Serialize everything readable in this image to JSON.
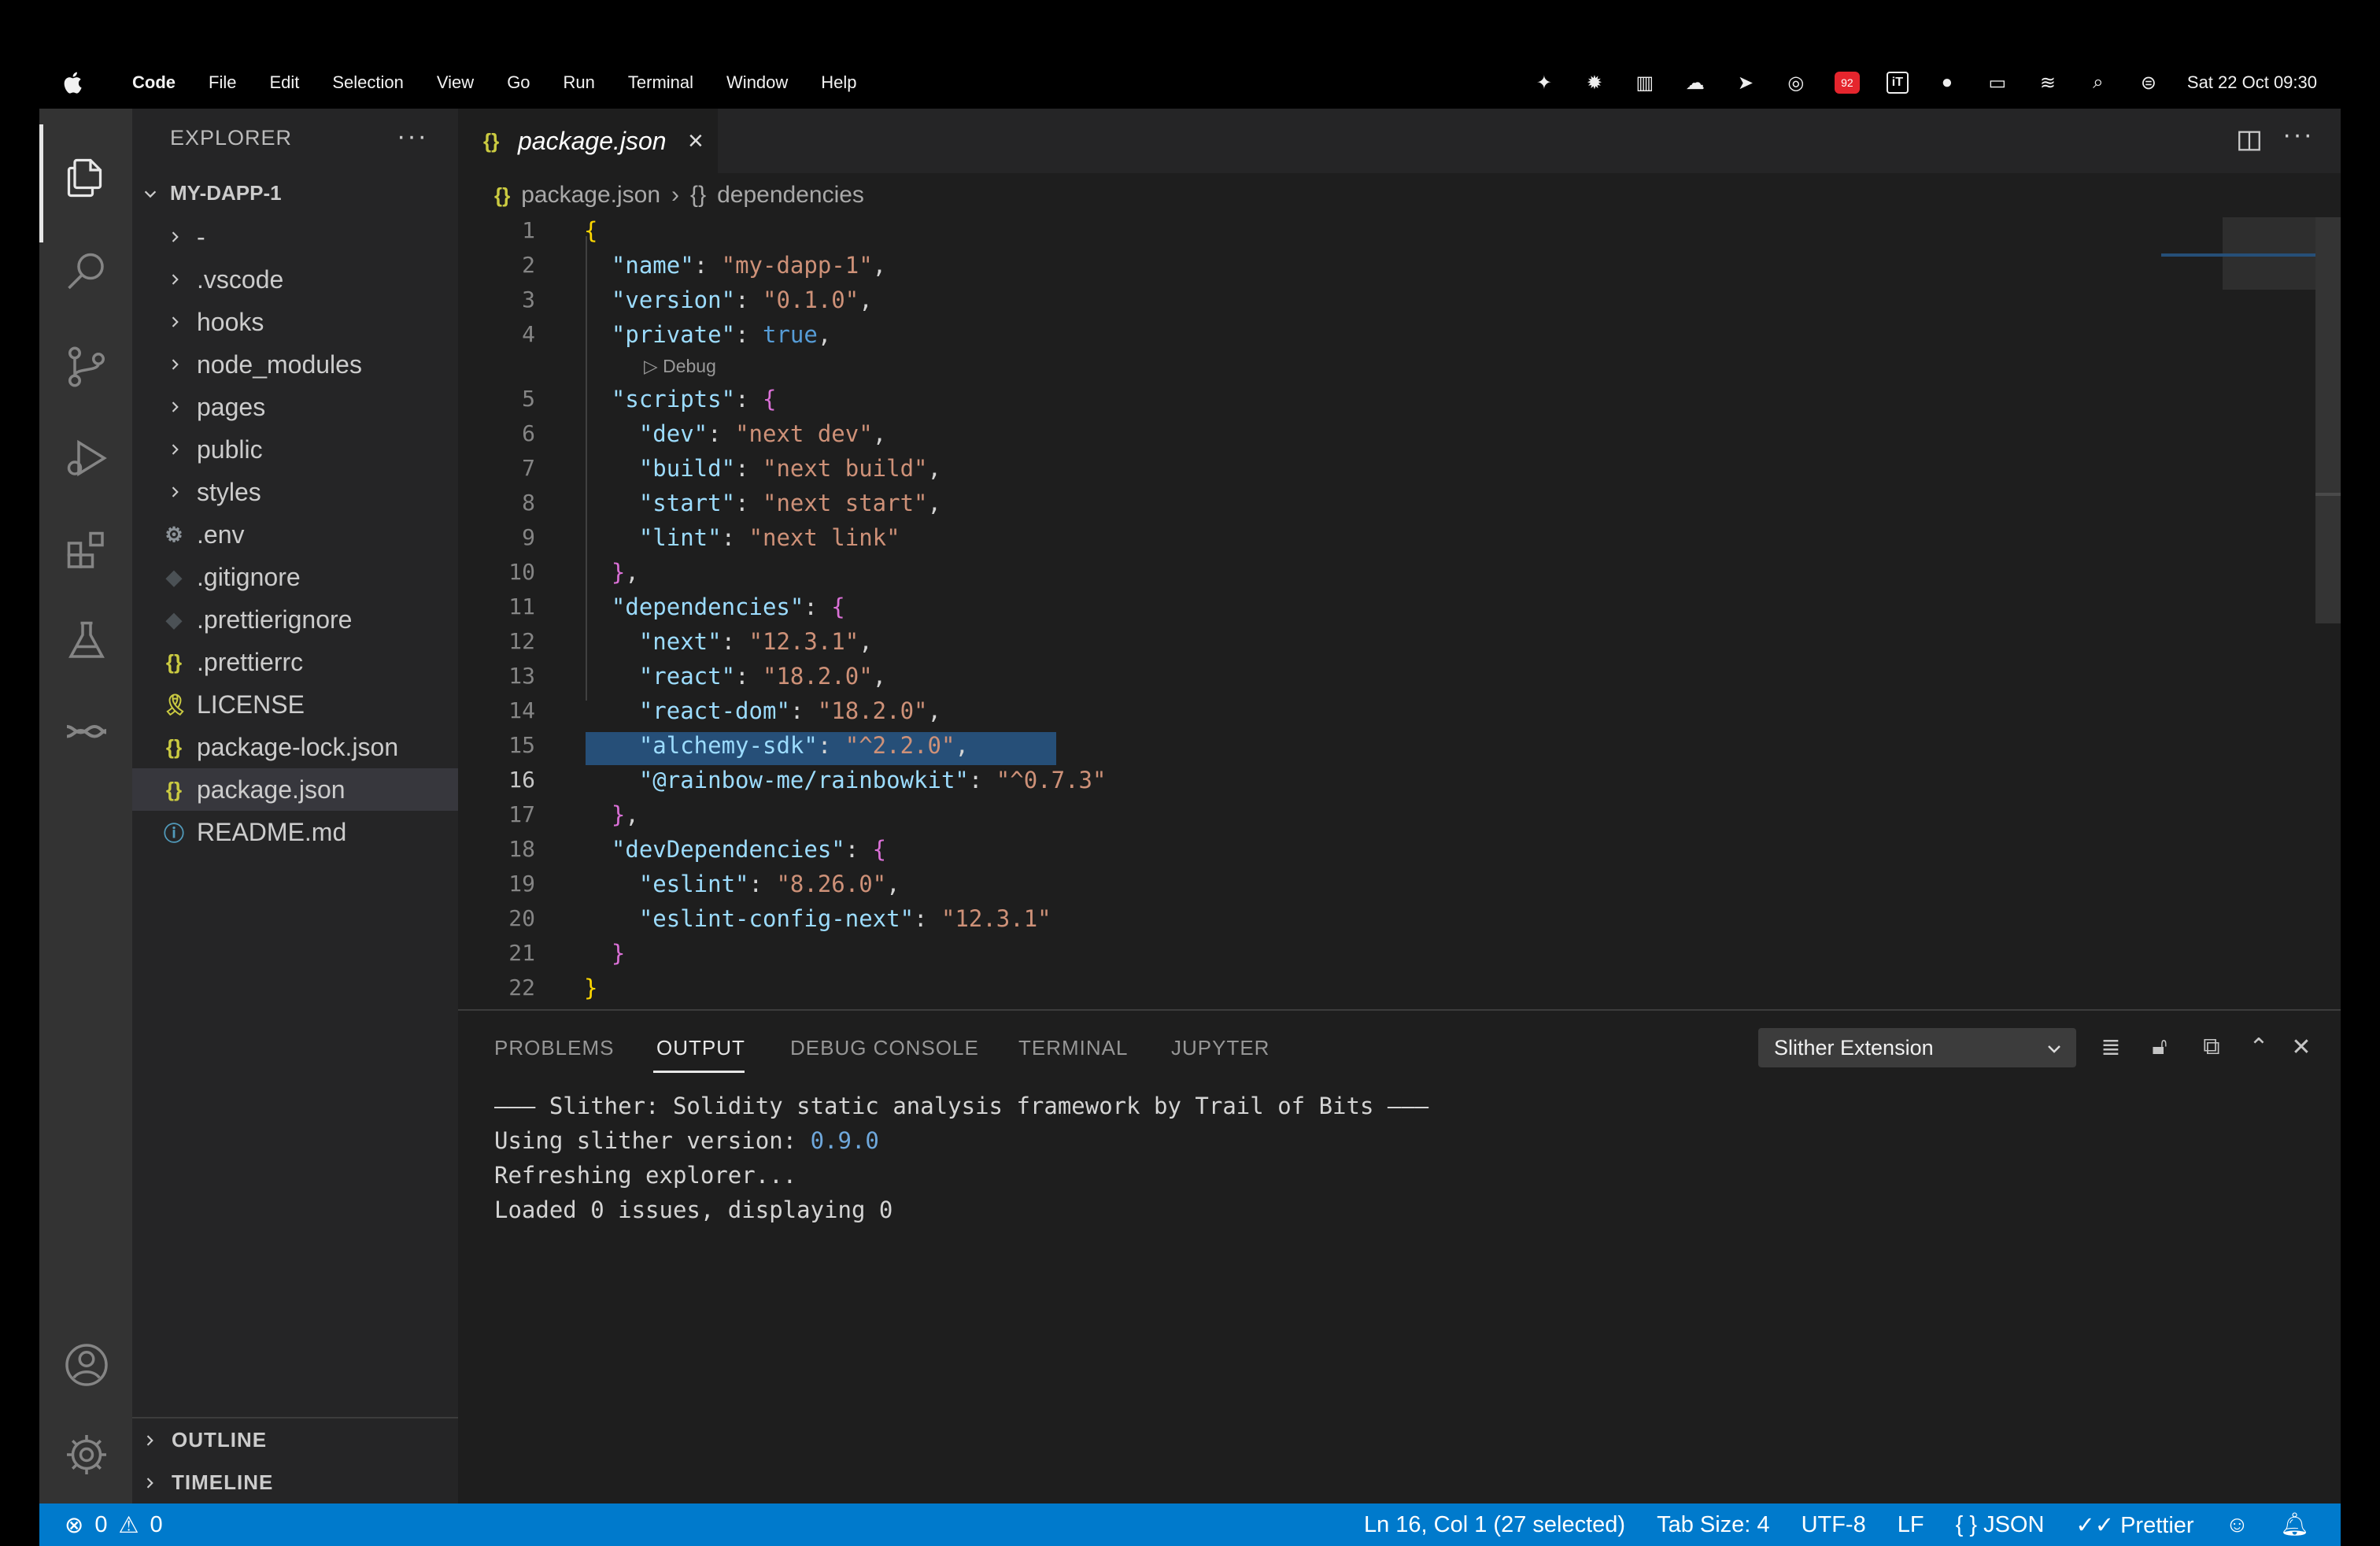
{
  "menubar": {
    "app_name": "Code",
    "items": [
      "File",
      "Edit",
      "Selection",
      "View",
      "Go",
      "Run",
      "Terminal",
      "Window",
      "Help"
    ],
    "clock": "Sat 22 Oct  09:30",
    "badge_count": "92",
    "box_icon_letter": "iT"
  },
  "sidebar": {
    "title": "EXPLORER",
    "root": "MY-DAPP-1",
    "items": [
      {
        "label": "-",
        "type": "folder"
      },
      {
        "label": ".vscode",
        "type": "folder"
      },
      {
        "label": "hooks",
        "type": "folder"
      },
      {
        "label": "node_modules",
        "type": "folder"
      },
      {
        "label": "pages",
        "type": "folder"
      },
      {
        "label": "public",
        "type": "folder"
      },
      {
        "label": "styles",
        "type": "folder"
      },
      {
        "label": ".env",
        "type": "gear"
      },
      {
        "label": ".gitignore",
        "type": "diamond"
      },
      {
        "label": ".prettierignore",
        "type": "diamond"
      },
      {
        "label": ".prettierrc",
        "type": "json"
      },
      {
        "label": "LICENSE",
        "type": "license"
      },
      {
        "label": "package-lock.json",
        "type": "json"
      },
      {
        "label": "package.json",
        "type": "json"
      },
      {
        "label": "README.md",
        "type": "info"
      }
    ],
    "outline": "OUTLINE",
    "timeline": "TIMELINE"
  },
  "editor": {
    "tab_label": "package.json",
    "breadcrumb": [
      "package.json",
      "dependencies"
    ],
    "codelens": "Debug",
    "line_numbers": [
      "1",
      "2",
      "3",
      "4",
      "5",
      "6",
      "7",
      "8",
      "9",
      "10",
      "11",
      "12",
      "13",
      "14",
      "15",
      "16",
      "17",
      "18",
      "19",
      "20",
      "21",
      "22"
    ],
    "current_line": "16"
  },
  "panel": {
    "tabs": [
      "PROBLEMS",
      "OUTPUT",
      "DEBUG CONSOLE",
      "TERMINAL",
      "JUPYTER"
    ],
    "active_tab": "OUTPUT",
    "channel": "Slither Extension",
    "output_line1": "——— Slither: Solidity static analysis framework by Trail of Bits ———",
    "output_line2_prefix": "Using slither version: ",
    "output_version": "0.9.0",
    "output_line3": "Refreshing explorer...",
    "output_line4": "Loaded 0 issues, displaying 0"
  },
  "statusbar": {
    "errors": "0",
    "warnings": "0",
    "position": "Ln 16, Col 1 (27 selected)",
    "tab_size": "Tab Size: 4",
    "encoding": "UTF-8",
    "eol": "LF",
    "language": "JSON",
    "formatter": "Prettier"
  },
  "colors": {
    "statusbar": "#007acc",
    "selection": "#264f78",
    "key": "#9cdcfe",
    "string": "#ce9178"
  }
}
